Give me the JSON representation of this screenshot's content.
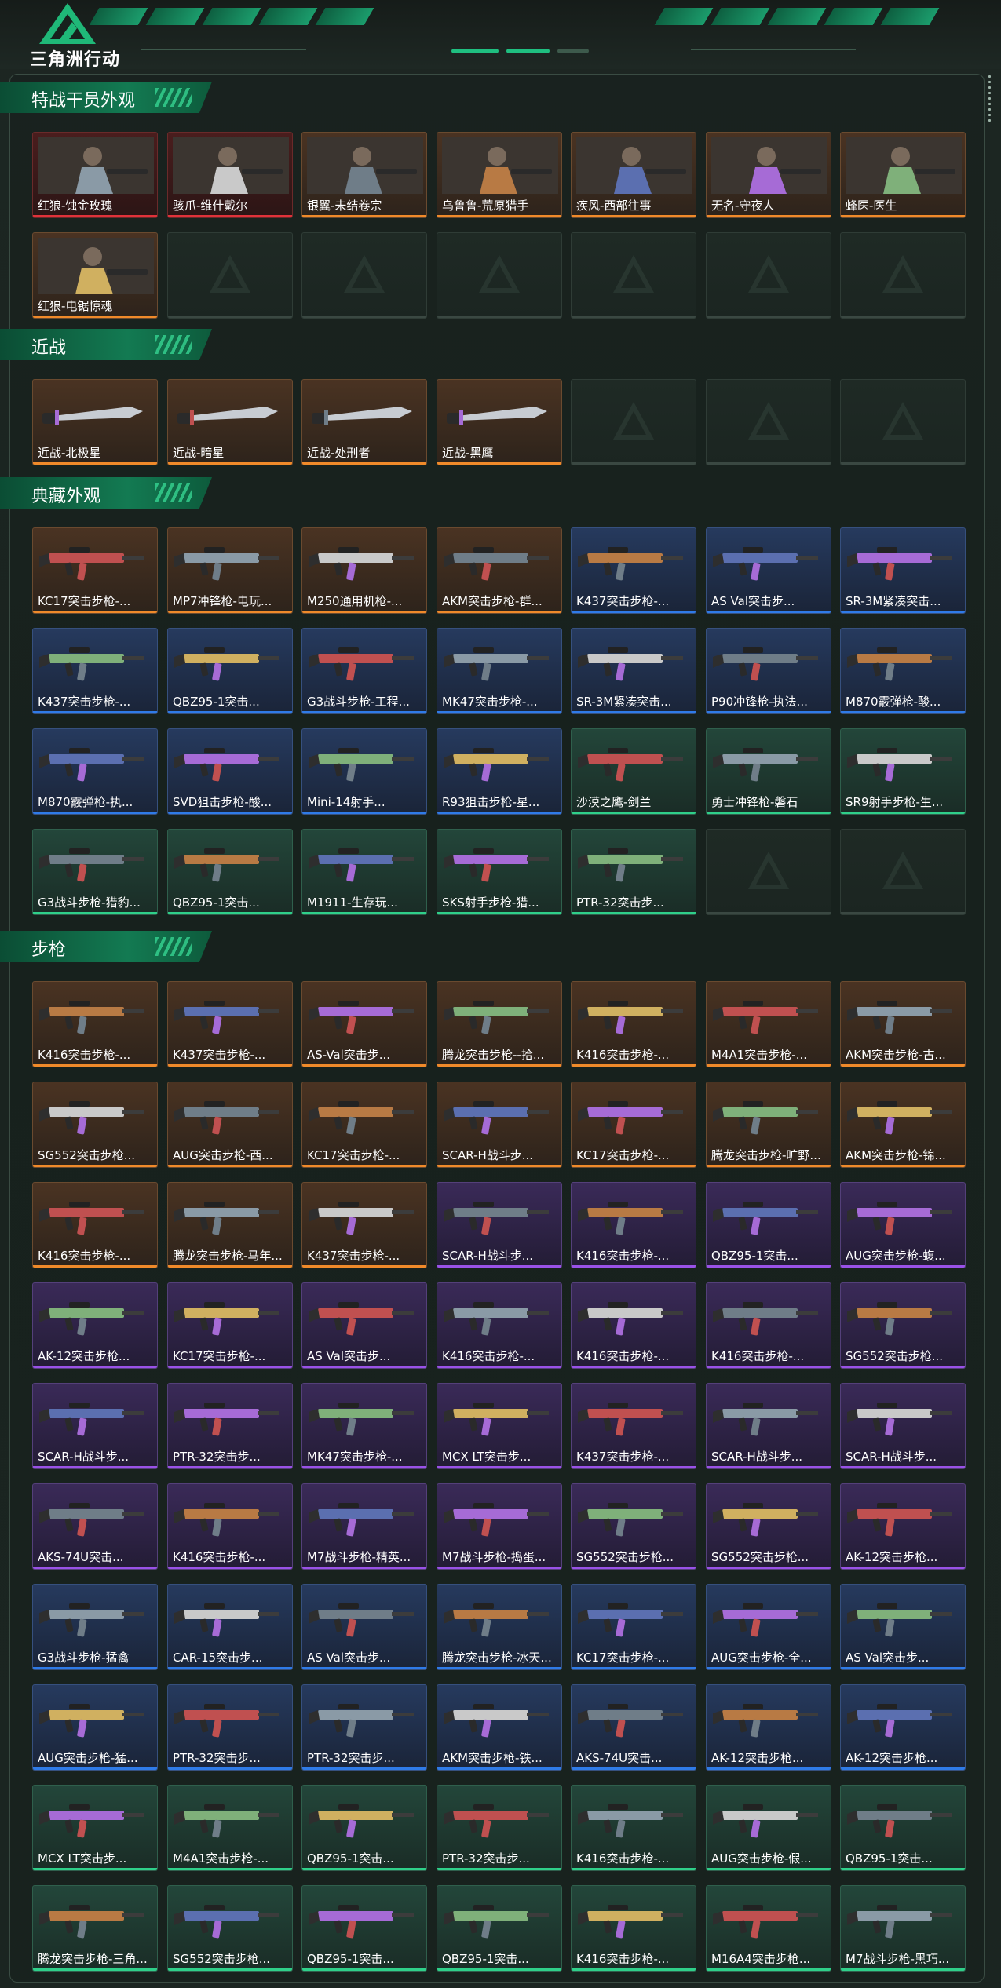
{
  "app": {
    "title": "三角洲行动"
  },
  "colors": {
    "accent": "#1fbf80",
    "rarity_red": "#e0323a",
    "rarity_orange": "#f08a2a",
    "rarity_purple": "#9a52e8",
    "rarity_blue": "#2f7be8",
    "rarity_green": "#2fd08a"
  },
  "sections": [
    {
      "title": "特战干员外观",
      "items": [
        {
          "name": "红狼-蚀金玫瑰",
          "rarity": "red",
          "art": "operator"
        },
        {
          "name": "骇爪-维什戴尔",
          "rarity": "red",
          "art": "operator"
        },
        {
          "name": "银翼-未结卷宗",
          "rarity": "orange",
          "art": "operator"
        },
        {
          "name": "乌鲁鲁-荒原猎手",
          "rarity": "orange",
          "art": "operator"
        },
        {
          "name": "疾风-西部往事",
          "rarity": "orange",
          "art": "operator"
        },
        {
          "name": "无名-守夜人",
          "rarity": "orange",
          "art": "operator"
        },
        {
          "name": "蜂医-医生",
          "rarity": "orange",
          "art": "operator"
        },
        {
          "name": "红狼-电锯惊魂",
          "rarity": "orange",
          "art": "operator"
        },
        {
          "empty": true
        },
        {
          "empty": true
        },
        {
          "empty": true
        },
        {
          "empty": true
        },
        {
          "empty": true
        },
        {
          "empty": true
        }
      ]
    },
    {
      "title": "近战",
      "items": [
        {
          "name": "近战-北极星",
          "rarity": "orange",
          "art": "knife"
        },
        {
          "name": "近战-暗星",
          "rarity": "orange",
          "art": "knife"
        },
        {
          "name": "近战-处刑者",
          "rarity": "orange",
          "art": "knife"
        },
        {
          "name": "近战-黑鹰",
          "rarity": "orange",
          "art": "knife"
        },
        {
          "empty": true
        },
        {
          "empty": true
        },
        {
          "empty": true
        }
      ]
    },
    {
      "title": "典藏外观",
      "items": [
        {
          "name": "KC17突击步枪-...",
          "rarity": "orange",
          "art": "gun"
        },
        {
          "name": "MP7冲锋枪-电玩...",
          "rarity": "orange",
          "art": "gun"
        },
        {
          "name": "M250通用机枪-...",
          "rarity": "orange",
          "art": "gun"
        },
        {
          "name": "AKM突击步枪-群...",
          "rarity": "orange",
          "art": "gun"
        },
        {
          "name": "K437突击步枪-...",
          "rarity": "blue",
          "art": "gun"
        },
        {
          "name": "AS Val突击步...",
          "rarity": "blue",
          "art": "gun"
        },
        {
          "name": "SR-3M紧凑突击...",
          "rarity": "blue",
          "art": "gun"
        },
        {
          "name": "K437突击步枪-...",
          "rarity": "blue",
          "art": "gun"
        },
        {
          "name": "QBZ95-1突击...",
          "rarity": "blue",
          "art": "gun"
        },
        {
          "name": "G3战斗步枪-工程...",
          "rarity": "blue",
          "art": "gun"
        },
        {
          "name": "MK47突击步枪-...",
          "rarity": "blue",
          "art": "gun"
        },
        {
          "name": "SR-3M紧凑突击...",
          "rarity": "blue",
          "art": "gun"
        },
        {
          "name": "P90冲锋枪-执法...",
          "rarity": "blue",
          "art": "gun"
        },
        {
          "name": "M870霰弹枪-酸...",
          "rarity": "blue",
          "art": "gun"
        },
        {
          "name": "M870霰弹枪-执...",
          "rarity": "blue",
          "art": "gun"
        },
        {
          "name": "SVD狙击步枪-酸...",
          "rarity": "blue",
          "art": "gun"
        },
        {
          "name": "Mini-14射手...",
          "rarity": "blue",
          "art": "gun"
        },
        {
          "name": "R93狙击步枪-星...",
          "rarity": "blue",
          "art": "gun"
        },
        {
          "name": "沙漠之鹰-剑兰",
          "rarity": "green",
          "art": "gun"
        },
        {
          "name": "勇士冲锋枪-磐石",
          "rarity": "green",
          "art": "gun"
        },
        {
          "name": "SR9射手步枪-生...",
          "rarity": "green",
          "art": "gun"
        },
        {
          "name": "G3战斗步枪-猎豹...",
          "rarity": "green",
          "art": "gun"
        },
        {
          "name": "QBZ95-1突击...",
          "rarity": "green",
          "art": "gun"
        },
        {
          "name": "M1911-生存玩...",
          "rarity": "green",
          "art": "gun"
        },
        {
          "name": "SKS射手步枪-猎...",
          "rarity": "green",
          "art": "gun"
        },
        {
          "name": "PTR-32突击步...",
          "rarity": "green",
          "art": "gun"
        },
        {
          "empty": true
        },
        {
          "empty": true
        }
      ]
    },
    {
      "title": "步枪",
      "items": [
        {
          "name": "K416突击步枪-...",
          "rarity": "orange",
          "art": "gun"
        },
        {
          "name": "K437突击步枪-...",
          "rarity": "orange",
          "art": "gun"
        },
        {
          "name": "AS-Val突击步...",
          "rarity": "orange",
          "art": "gun"
        },
        {
          "name": "腾龙突击步枪--拾...",
          "rarity": "orange",
          "art": "gun"
        },
        {
          "name": "K416突击步枪-...",
          "rarity": "orange",
          "art": "gun"
        },
        {
          "name": "M4A1突击步枪-...",
          "rarity": "orange",
          "art": "gun"
        },
        {
          "name": "AKM突击步枪-古...",
          "rarity": "orange",
          "art": "gun"
        },
        {
          "name": "SG552突击步枪...",
          "rarity": "orange",
          "art": "gun"
        },
        {
          "name": "AUG突击步枪-西...",
          "rarity": "orange",
          "art": "gun"
        },
        {
          "name": "KC17突击步枪-...",
          "rarity": "orange",
          "art": "gun"
        },
        {
          "name": "SCAR-H战斗步...",
          "rarity": "orange",
          "art": "gun"
        },
        {
          "name": "KC17突击步枪-...",
          "rarity": "orange",
          "art": "gun"
        },
        {
          "name": "腾龙突击步枪-旷野...",
          "rarity": "orange",
          "art": "gun"
        },
        {
          "name": "AKM突击步枪-锦...",
          "rarity": "orange",
          "art": "gun"
        },
        {
          "name": "K416突击步枪-...",
          "rarity": "orange",
          "art": "gun"
        },
        {
          "name": "腾龙突击步枪-马年...",
          "rarity": "orange",
          "art": "gun"
        },
        {
          "name": "K437突击步枪-...",
          "rarity": "orange",
          "art": "gun"
        },
        {
          "name": "SCAR-H战斗步...",
          "rarity": "purple",
          "art": "gun"
        },
        {
          "name": "K416突击步枪-...",
          "rarity": "purple",
          "art": "gun"
        },
        {
          "name": "QBZ95-1突击...",
          "rarity": "purple",
          "art": "gun"
        },
        {
          "name": "AUG突击步枪-蝮...",
          "rarity": "purple",
          "art": "gun"
        },
        {
          "name": "AK-12突击步枪...",
          "rarity": "purple",
          "art": "gun"
        },
        {
          "name": "KC17突击步枪-...",
          "rarity": "purple",
          "art": "gun"
        },
        {
          "name": "AS Val突击步...",
          "rarity": "purple",
          "art": "gun"
        },
        {
          "name": "K416突击步枪-...",
          "rarity": "purple",
          "art": "gun"
        },
        {
          "name": "K416突击步枪-...",
          "rarity": "purple",
          "art": "gun"
        },
        {
          "name": "K416突击步枪-...",
          "rarity": "purple",
          "art": "gun"
        },
        {
          "name": "SG552突击步枪...",
          "rarity": "purple",
          "art": "gun"
        },
        {
          "name": "SCAR-H战斗步...",
          "rarity": "purple",
          "art": "gun"
        },
        {
          "name": "PTR-32突击步...",
          "rarity": "purple",
          "art": "gun"
        },
        {
          "name": "MK47突击步枪-...",
          "rarity": "purple",
          "art": "gun"
        },
        {
          "name": "MCX LT突击步...",
          "rarity": "purple",
          "art": "gun"
        },
        {
          "name": "K437突击步枪-...",
          "rarity": "purple",
          "art": "gun"
        },
        {
          "name": "SCAR-H战斗步...",
          "rarity": "purple",
          "art": "gun"
        },
        {
          "name": "SCAR-H战斗步...",
          "rarity": "purple",
          "art": "gun"
        },
        {
          "name": "AKS-74U突击...",
          "rarity": "purple",
          "art": "gun"
        },
        {
          "name": "K416突击步枪-...",
          "rarity": "purple",
          "art": "gun"
        },
        {
          "name": "M7战斗步枪-精英...",
          "rarity": "purple",
          "art": "gun"
        },
        {
          "name": "M7战斗步枪-捣蛋...",
          "rarity": "purple",
          "art": "gun"
        },
        {
          "name": "SG552突击步枪...",
          "rarity": "purple",
          "art": "gun"
        },
        {
          "name": "SG552突击步枪...",
          "rarity": "purple",
          "art": "gun"
        },
        {
          "name": "AK-12突击步枪...",
          "rarity": "purple",
          "art": "gun"
        },
        {
          "name": "G3战斗步枪-猛禽",
          "rarity": "blue",
          "art": "gun"
        },
        {
          "name": "CAR-15突击步...",
          "rarity": "blue",
          "art": "gun"
        },
        {
          "name": "AS Val突击步...",
          "rarity": "blue",
          "art": "gun"
        },
        {
          "name": "腾龙突击步枪-冰天...",
          "rarity": "blue",
          "art": "gun"
        },
        {
          "name": "KC17突击步枪-...",
          "rarity": "blue",
          "art": "gun"
        },
        {
          "name": "AUG突击步枪-全...",
          "rarity": "blue",
          "art": "gun"
        },
        {
          "name": "AS Val突击步...",
          "rarity": "blue",
          "art": "gun"
        },
        {
          "name": "AUG突击步枪-猛...",
          "rarity": "blue",
          "art": "gun"
        },
        {
          "name": "PTR-32突击步...",
          "rarity": "blue",
          "art": "gun"
        },
        {
          "name": "PTR-32突击步...",
          "rarity": "blue",
          "art": "gun"
        },
        {
          "name": "AKM突击步枪-铁...",
          "rarity": "blue",
          "art": "gun"
        },
        {
          "name": "AKS-74U突击...",
          "rarity": "blue",
          "art": "gun"
        },
        {
          "name": "AK-12突击步枪...",
          "rarity": "blue",
          "art": "gun"
        },
        {
          "name": "AK-12突击步枪...",
          "rarity": "blue",
          "art": "gun"
        },
        {
          "name": "MCX LT突击步...",
          "rarity": "green",
          "art": "gun"
        },
        {
          "name": "M4A1突击步枪-...",
          "rarity": "green",
          "art": "gun"
        },
        {
          "name": "QBZ95-1突击...",
          "rarity": "green",
          "art": "gun"
        },
        {
          "name": "PTR-32突击步...",
          "rarity": "green",
          "art": "gun"
        },
        {
          "name": "K416突击步枪-...",
          "rarity": "green",
          "art": "gun"
        },
        {
          "name": "AUG突击步枪-假...",
          "rarity": "green",
          "art": "gun"
        },
        {
          "name": "QBZ95-1突击...",
          "rarity": "green",
          "art": "gun"
        },
        {
          "name": "腾龙突击步枪-三角...",
          "rarity": "green",
          "art": "gun"
        },
        {
          "name": "SG552突击步枪...",
          "rarity": "green",
          "art": "gun"
        },
        {
          "name": "QBZ95-1突击...",
          "rarity": "green",
          "art": "gun"
        },
        {
          "name": "QBZ95-1突击...",
          "rarity": "green",
          "art": "gun"
        },
        {
          "name": "K416突击步枪-...",
          "rarity": "green",
          "art": "gun"
        },
        {
          "name": "M16A4突击步枪...",
          "rarity": "green",
          "art": "gun"
        },
        {
          "name": "M7战斗步枪-黑巧...",
          "rarity": "green",
          "art": "gun"
        }
      ]
    }
  ]
}
